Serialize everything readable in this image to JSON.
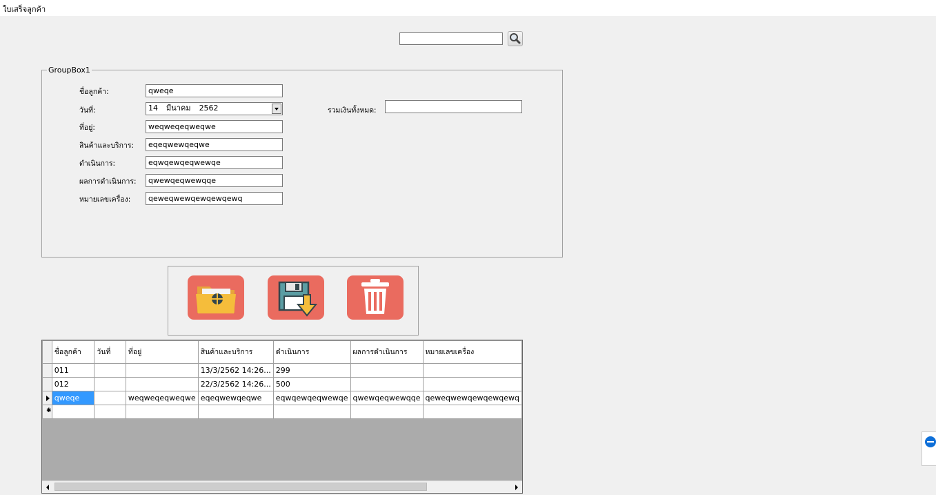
{
  "window": {
    "title": "ใบเสร็จลูกค้า"
  },
  "search": {
    "value": "",
    "icon": "magnifier-icon"
  },
  "groupbox": {
    "title": "GroupBox1",
    "fields": {
      "customer": {
        "label": "ชื่อลูกค้า:",
        "value": "qweqe"
      },
      "date": {
        "label": "วันที่:",
        "day": "14",
        "month": "มีนาคม",
        "year": "2562"
      },
      "address": {
        "label": "ที่อยู่:",
        "value": "weqweqeqweqwe"
      },
      "products": {
        "label": "สินค้าและบริการ:",
        "value": "eqeqwewqeqwe"
      },
      "operation": {
        "label": "ดำเนินการ:",
        "value": "eqwqewqeqwewqe"
      },
      "result": {
        "label": "ผลการดำเนินการ:",
        "value": "qwewqeqwewqqe"
      },
      "machine_no": {
        "label": "หมายเลขเครื่อง:",
        "value": "qeweqwewqewqewqewq"
      },
      "total": {
        "label": "รวมเงินทั้งหมด:",
        "value": ""
      }
    }
  },
  "toolbar": {
    "open_icon": "folder-icon",
    "save_icon": "floppy-save-icon",
    "delete_icon": "trash-icon",
    "accent_color": "#ea6b5f"
  },
  "grid": {
    "columns": [
      "ชื่อลูกค้า",
      "วันที่",
      "ที่อยู่",
      "สินค้าและบริการ",
      "ดำเนินการ",
      "ผลการดำเนินการ",
      "หมายเลขเครื่อง"
    ],
    "rows": [
      [
        "011",
        "",
        "",
        "13/3/2562 14:26...",
        "299",
        "",
        ""
      ],
      [
        "012",
        "",
        "",
        "22/3/2562 14:26...",
        "500",
        "",
        ""
      ],
      [
        "qweqe",
        "",
        "weqweqeqweqwe",
        "eqeqwewqeqwe",
        "eqwqewqeqwewqe",
        "qwewqeqwewqqe",
        "qeweqwewqewqewqewq"
      ]
    ]
  }
}
